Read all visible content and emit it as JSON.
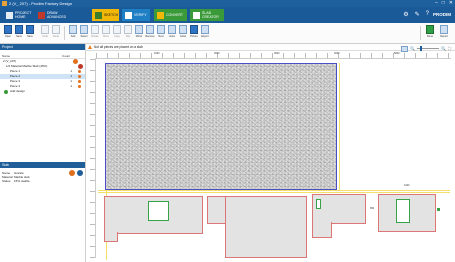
{
  "window": {
    "title": "2 (V_ 207) - Prodim Factory Design",
    "controls": [
      "–",
      "□",
      "✕"
    ]
  },
  "tabs": [
    {
      "label": "PROJECT\nHOME",
      "icon": "home-icon"
    },
    {
      "label": "DRAW\nADVANCED",
      "icon": "draw-icon"
    },
    {
      "label": "SKETCH",
      "icon": "sketch-icon"
    },
    {
      "label": "VERIFY",
      "icon": "verify-icon"
    },
    {
      "label": "CONVERT",
      "icon": "convert-icon"
    },
    {
      "label": "SLAB\nCREATOR",
      "icon": "slab-icon"
    }
  ],
  "top_right_icons": [
    "gear-icon",
    "pin-icon",
    "help-icon"
  ],
  "brand": "PRODIM",
  "toolbar": {
    "left": [
      {
        "label": "Open",
        "icon": "open-icon"
      },
      {
        "label": "Save",
        "icon": "save-icon"
      },
      {
        "label": "Save",
        "icon": "save-as-icon"
      },
      {
        "label": "Undo",
        "icon": "undo-icon"
      },
      {
        "label": "Redo",
        "icon": "redo-icon"
      }
    ],
    "middle": [
      {
        "label": "Add",
        "icon": "add-slab-icon"
      },
      {
        "label": "Select",
        "icon": "select-icon"
      },
      {
        "label": "Rotate",
        "icon": "rotate-icon"
      },
      {
        "label": "Move",
        "icon": "move-icon"
      },
      {
        "label": "Copy",
        "icon": "copy-icon"
      },
      {
        "label": "Flip",
        "icon": "flip-icon"
      },
      {
        "label": "Mirror",
        "icon": "mirror-icon"
      },
      {
        "label": "Remove",
        "icon": "remove-icon"
      },
      {
        "label": "Nest",
        "icon": "nest-icon"
      },
      {
        "label": "Veins",
        "icon": "veins-icon"
      },
      {
        "label": "Joints",
        "icon": "joints-icon"
      },
      {
        "label": "Picture",
        "icon": "picture-icon"
      },
      {
        "label": "Export",
        "icon": "export-icon"
      }
    ],
    "right": [
      {
        "label": "Done",
        "icon": "done-icon"
      },
      {
        "label": "Report",
        "icon": "report-icon"
      }
    ]
  },
  "project_panel": {
    "header": "Project",
    "columns": {
      "name": "Name",
      "qty": "Count"
    },
    "rows": [
      {
        "name": "2 (V_207)",
        "qty": "",
        "indent": 1
      },
      {
        "name": "1/2 Material Marble Slab (45%)",
        "qty": "",
        "indent": 2
      },
      {
        "name": "Piece 1",
        "qty": "1",
        "indent": 3
      },
      {
        "name": "Piece 2",
        "qty": "1",
        "indent": 3,
        "selected": true
      },
      {
        "name": "Piece 3",
        "qty": "1",
        "indent": 3
      },
      {
        "name": "Piece 4",
        "qty": "1",
        "indent": 3
      },
      {
        "name": "Add design",
        "qty": "",
        "indent": 1,
        "add": true
      }
    ]
  },
  "properties_panel": {
    "header": "Slab",
    "rows": [
      {
        "key": "Name",
        "value": "Granite"
      },
      {
        "key": "Material",
        "value": "Marble slab"
      },
      {
        "key": "Status",
        "value": "15% usable"
      }
    ]
  },
  "canvas": {
    "warning": "Not all pieces are placed on a slab",
    "zoom_buttons": [
      "zoom-fit-icon",
      "zoom-out-icon",
      "zoom-in-icon"
    ],
    "ruler_labels": [
      "1000",
      "2000",
      "3000",
      "4000",
      "5000"
    ],
    "dims": [
      "1200",
      "650"
    ]
  }
}
